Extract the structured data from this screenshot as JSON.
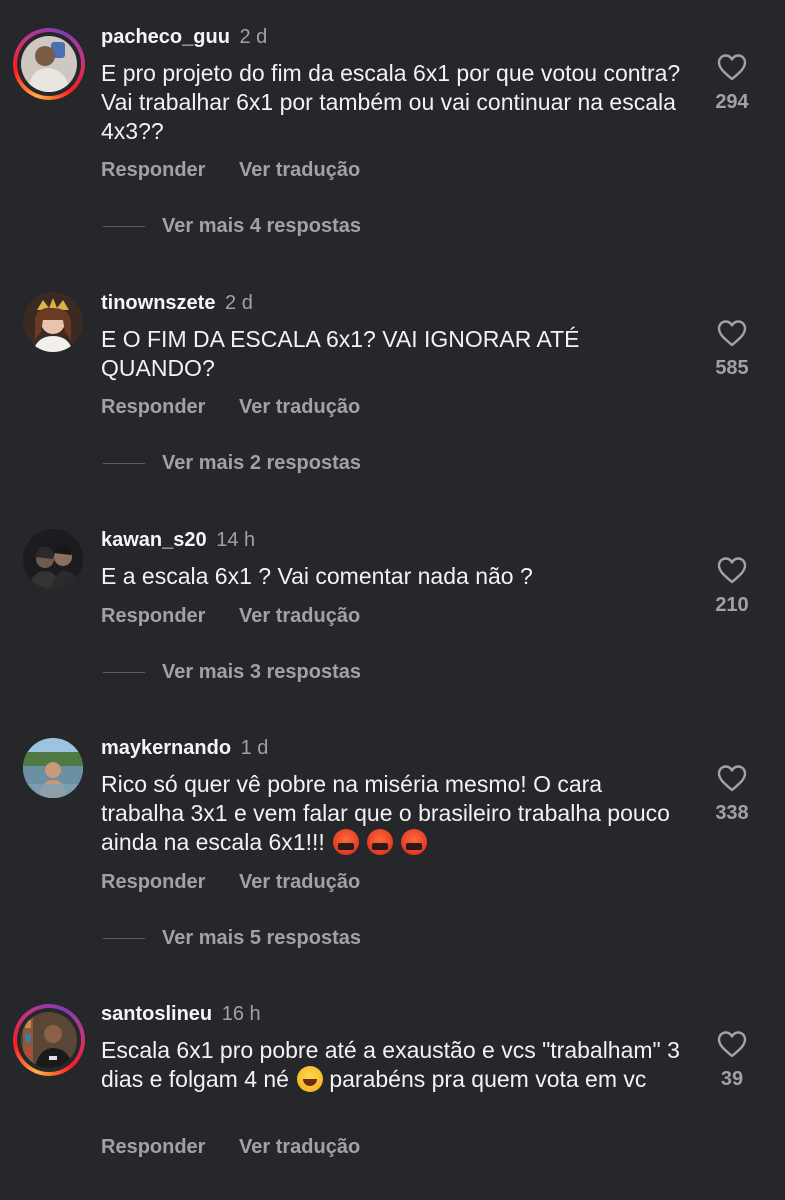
{
  "comments": [
    {
      "username": "pacheco_guu",
      "time": "2 d",
      "text": "E pro projeto do fim da escala 6x1 por que votou contra? Vai trabalhar 6x1 por também ou vai continuar na escala 4x3??",
      "likes": "294",
      "reply_label": "Responder",
      "translate_label": "Ver tradução",
      "more_replies": "Ver mais 4 respostas",
      "has_story_ring": true
    },
    {
      "username": "tinownszete",
      "time": "2 d",
      "text": "E O FIM DA ESCALA 6x1? VAI IGNORAR ATÉ QUANDO?",
      "likes": "585",
      "reply_label": "Responder",
      "translate_label": "Ver tradução",
      "more_replies": "Ver mais 2 respostas",
      "has_story_ring": false
    },
    {
      "username": "kawan_s20",
      "time": "14 h",
      "text": "E a escala 6x1 ? Vai comentar nada não ?",
      "likes": "210",
      "reply_label": "Responder",
      "translate_label": "Ver tradução",
      "more_replies": "Ver mais 3 respostas",
      "has_story_ring": false
    },
    {
      "username": "maykernando",
      "time": "1 d",
      "text": "Rico só quer vê pobre na miséria mesmo! O cara trabalha 3x1 e vem falar que o brasileiro trabalha pouco ainda na escala 6x1!!!",
      "emojis": [
        "angry-face-emoji",
        "angry-face-emoji",
        "angry-face-emoji"
      ],
      "likes": "338",
      "reply_label": "Responder",
      "translate_label": "Ver tradução",
      "more_replies": "Ver mais 5 respostas",
      "has_story_ring": false
    },
    {
      "username": "santoslineu",
      "time": "16 h",
      "text_before_emoji": "Escala 6x1 pro pobre até a exaustão e vcs \"trabalham\" 3 dias e folgam 4 né",
      "emoji": "laughing-face-emoji",
      "text_after_emoji": " parabéns pra quem vota em vc",
      "likes": "39",
      "reply_label": "Responder",
      "translate_label": "Ver tradução",
      "has_story_ring": true
    }
  ],
  "colors": {
    "background": "#25272b",
    "text": "#f2f2f2",
    "secondary_text": "#a0a2a6",
    "story_ring": [
      "#fcb045",
      "#fd1d1d",
      "#c13584",
      "#833ab4"
    ]
  },
  "icons": {
    "like": "heart-outline-icon"
  }
}
